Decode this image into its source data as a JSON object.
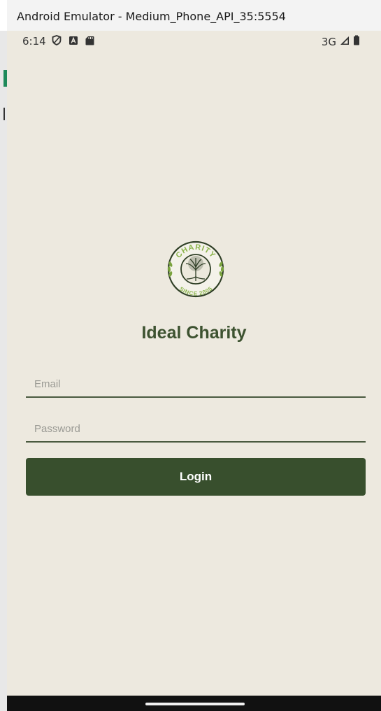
{
  "window": {
    "title": "Android Emulator - Medium_Phone_API_35:5554"
  },
  "status_bar": {
    "time": "6:14",
    "network": "3G",
    "left_icons": [
      "shield-icon",
      "a-box-icon",
      "sd-card-icon"
    ],
    "right_icons": [
      "signal-icon",
      "battery-icon"
    ]
  },
  "app": {
    "logo": {
      "top_text": "CHARITY",
      "bottom_text": "SINCE 2005"
    },
    "title": "Ideal Charity",
    "email_placeholder": "Email",
    "password_placeholder": "Password",
    "login_label": "Login"
  },
  "colors": {
    "background": "#ede9df",
    "accent": "#384f2d",
    "title": "#3d5230",
    "logo_green": "#8ab34a"
  }
}
